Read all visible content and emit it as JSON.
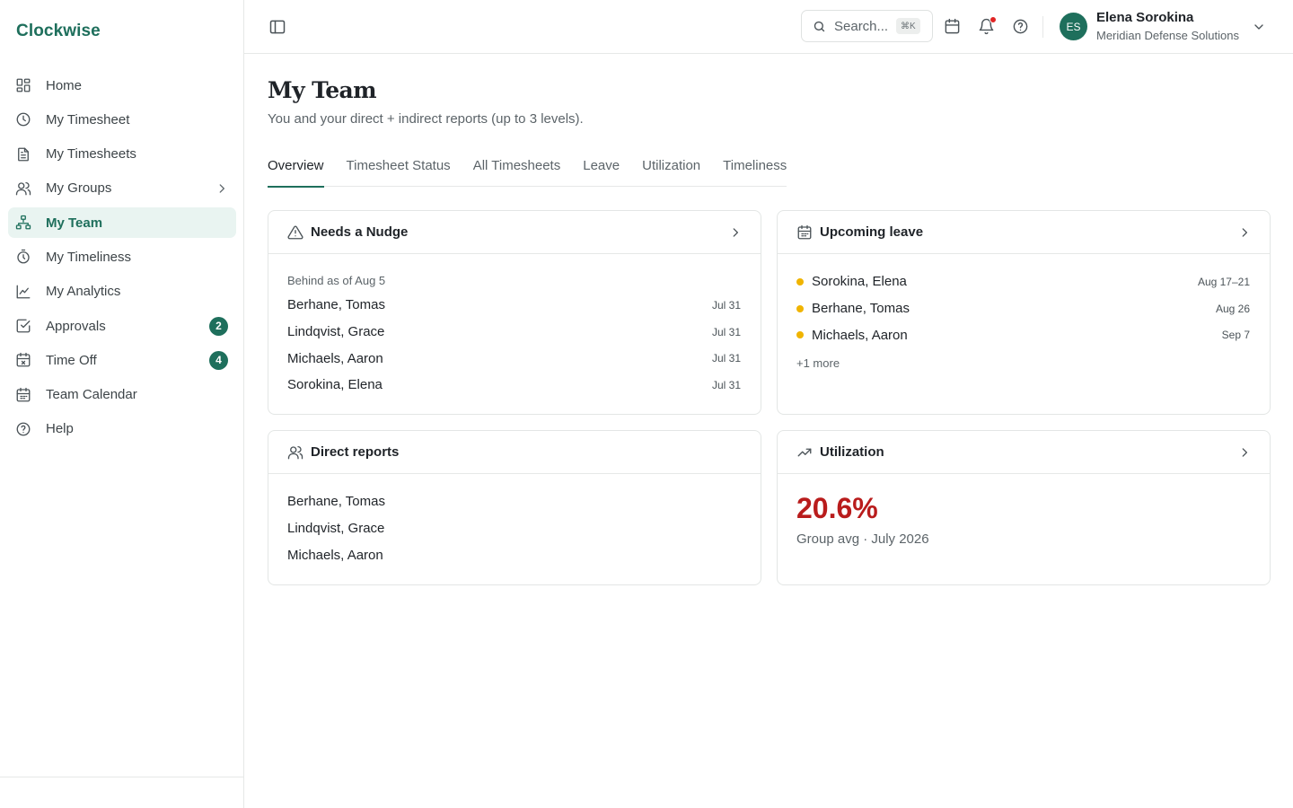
{
  "app": {
    "brand": "Clockwise"
  },
  "sidebar": {
    "items": [
      {
        "label": "Home",
        "icon": "dashboard-icon"
      },
      {
        "label": "My Timesheet",
        "icon": "clock-icon"
      },
      {
        "label": "My Timesheets",
        "icon": "document-icon"
      },
      {
        "label": "My Groups",
        "icon": "users-icon",
        "has_chevron": true
      },
      {
        "label": "My Team",
        "icon": "org-chart-icon",
        "active": true
      },
      {
        "label": "My Timeliness",
        "icon": "stopwatch-icon"
      },
      {
        "label": "My Analytics",
        "icon": "line-chart-icon"
      },
      {
        "label": "Approvals",
        "icon": "check-square-icon",
        "badge": "2"
      },
      {
        "label": "Time Off",
        "icon": "calendar-x-icon",
        "badge": "4"
      },
      {
        "label": "Team Calendar",
        "icon": "calendar-icon"
      },
      {
        "label": "Help",
        "icon": "help-circle-icon"
      }
    ]
  },
  "topbar": {
    "search_placeholder": "Search...",
    "search_shortcut": "⌘K",
    "user_initials": "ES",
    "user_name": "Elena Sorokina",
    "user_org": "Meridian Defense Solutions"
  },
  "page": {
    "title": "My Team",
    "subtitle": "You and your direct + indirect reports (up to 3 levels).",
    "tabs": [
      "Overview",
      "Timesheet Status",
      "All Timesheets",
      "Leave",
      "Utilization",
      "Timeliness"
    ],
    "active_tab": "Overview"
  },
  "cards": {
    "nudge": {
      "title": "Needs a Nudge",
      "sublabel": "Behind as of Aug 5",
      "rows": [
        {
          "name": "Berhane, Tomas",
          "date": "Jul 31"
        },
        {
          "name": "Lindqvist, Grace",
          "date": "Jul 31"
        },
        {
          "name": "Michaels, Aaron",
          "date": "Jul 31"
        },
        {
          "name": "Sorokina, Elena",
          "date": "Jul 31"
        }
      ]
    },
    "leave": {
      "title": "Upcoming leave",
      "rows": [
        {
          "name": "Sorokina, Elena",
          "date": "Aug 17–21"
        },
        {
          "name": "Berhane, Tomas",
          "date": "Aug 26"
        },
        {
          "name": "Michaels, Aaron",
          "date": "Sep 7"
        }
      ],
      "more": "+1 more",
      "dot_color": "#f0b400"
    },
    "reports": {
      "title": "Direct reports",
      "rows": [
        "Berhane, Tomas",
        "Lindqvist, Grace",
        "Michaels, Aaron"
      ]
    },
    "utilization": {
      "title": "Utilization",
      "value": "20.6%",
      "caption": "Group avg · July 2026",
      "value_color": "#b91c1c"
    }
  },
  "colors": {
    "accent": "#1e6f5c",
    "active_bg": "#e9f4f1",
    "notification": "#e02424"
  }
}
